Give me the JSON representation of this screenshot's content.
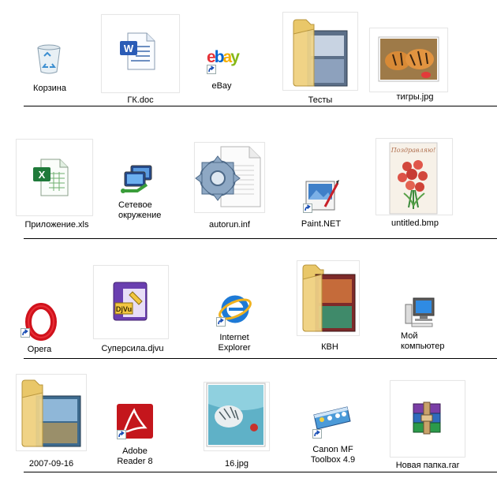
{
  "desktop": {
    "rows": [
      {
        "items": [
          {
            "label": "Корзина",
            "icon": "recycle-bin-icon"
          },
          {
            "label": "ГК.doc",
            "icon": "word-document-icon"
          },
          {
            "label": "eBay",
            "icon": "ebay-shortcut-icon"
          },
          {
            "label": "Тесты",
            "icon": "folder-icon"
          },
          {
            "label": "тигры.jpg",
            "icon": "image-thumbnail-icon"
          }
        ]
      },
      {
        "items": [
          {
            "label": "Приложение.xls",
            "icon": "excel-document-icon"
          },
          {
            "label": "Сетевое\nокружение",
            "icon": "network-icon"
          },
          {
            "label": "autorun.inf",
            "icon": "settings-file-icon"
          },
          {
            "label": "Paint.NET",
            "icon": "paint-net-icon"
          },
          {
            "label": "untitled.bmp",
            "icon": "image-thumbnail-icon"
          }
        ]
      },
      {
        "items": [
          {
            "label": "Opera",
            "icon": "opera-icon"
          },
          {
            "label": "Суперсила.djvu",
            "icon": "djvu-document-icon"
          },
          {
            "label": "Internet\nExplorer",
            "icon": "internet-explorer-icon"
          },
          {
            "label": "КВН",
            "icon": "folder-icon"
          },
          {
            "label": "Мой\nкомпьютер",
            "icon": "computer-icon"
          }
        ]
      },
      {
        "items": [
          {
            "label": "2007-09-16",
            "icon": "folder-icon"
          },
          {
            "label": "Adobe\nReader 8",
            "icon": "adobe-reader-icon"
          },
          {
            "label": "16.jpg",
            "icon": "image-thumbnail-icon"
          },
          {
            "label": "Canon MF\nToolbox 4.9",
            "icon": "canon-toolbox-icon"
          },
          {
            "label": "Новая папка.rar",
            "icon": "winrar-archive-icon"
          }
        ]
      }
    ]
  }
}
